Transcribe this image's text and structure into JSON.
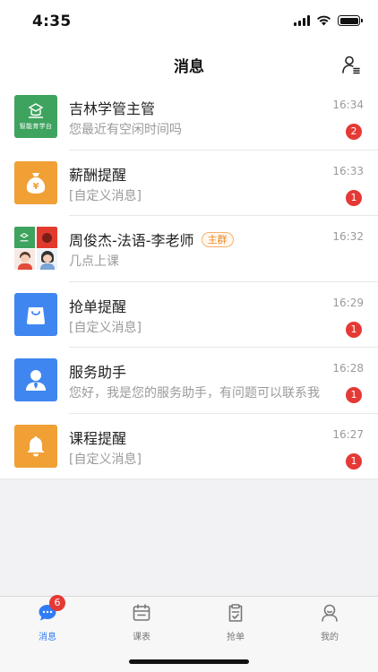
{
  "status_bar": {
    "time": "4:35"
  },
  "header": {
    "title": "消息",
    "contacts_icon": "person-list-icon"
  },
  "messages": [
    {
      "name": "吉林学管主管",
      "preview": "您最近有空闲时间吗",
      "time": "16:34",
      "unread": "2",
      "avatar": "organization-logo",
      "avatar_text": "智能育学台",
      "avatar_color": "#3ea35e"
    },
    {
      "name": "薪酬提醒",
      "preview": "[自定义消息]",
      "time": "16:33",
      "unread": "1",
      "avatar": "money-bag-icon",
      "avatar_color": "#f0a035"
    },
    {
      "name": "周俊杰-法语-李老师",
      "tag": "主群",
      "preview": "几点上课",
      "time": "16:32",
      "unread": "",
      "avatar": "group-avatar"
    },
    {
      "name": "抢单提醒",
      "preview": "[自定义消息]",
      "time": "16:29",
      "unread": "1",
      "avatar": "shopping-bag-icon",
      "avatar_color": "#3f86f0"
    },
    {
      "name": "服务助手",
      "preview": "您好，我是您的服务助手，有问题可以联系我",
      "time": "16:28",
      "unread": "1",
      "avatar": "assistant-person-icon",
      "avatar_color": "#3f86f0"
    },
    {
      "name": "课程提醒",
      "preview": "[自定义消息]",
      "time": "16:27",
      "unread": "1",
      "avatar": "bell-icon",
      "avatar_color": "#f0a035"
    }
  ],
  "tabs": [
    {
      "label": "消息",
      "icon": "chat-bubble-icon",
      "active": true,
      "badge": "6"
    },
    {
      "label": "课表",
      "icon": "calendar-icon",
      "active": false
    },
    {
      "label": "抢单",
      "icon": "clipboard-check-icon",
      "active": false
    },
    {
      "label": "我的",
      "icon": "profile-icon",
      "active": false
    }
  ],
  "colors": {
    "accent": "#2f7cf6",
    "badge": "#e53935",
    "orange": "#f0a035",
    "blue": "#3f86f0"
  }
}
